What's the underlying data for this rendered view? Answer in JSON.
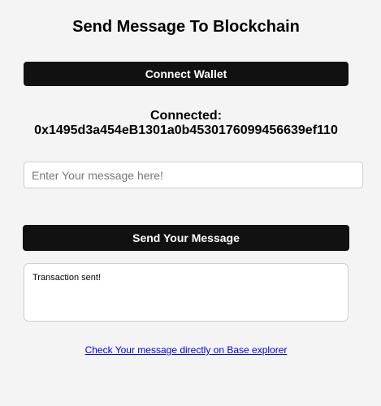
{
  "header": {
    "title": "Send Message To Blockchain"
  },
  "wallet": {
    "connect_label": "Connect Wallet",
    "connected_label": "Connected:",
    "address": "0x1495d3a454eB1301a0b4530176099456639ef110"
  },
  "message": {
    "value": "",
    "placeholder": "Enter Your message here!",
    "send_label": "Send Your Message"
  },
  "status": {
    "text": "Transaction sent!"
  },
  "link": {
    "explorer_text": "Check Your message directly on Base explorer"
  },
  "colors": {
    "button_bg": "#111111",
    "page_bg": "#f4f4f4",
    "link": "#0000ee"
  }
}
